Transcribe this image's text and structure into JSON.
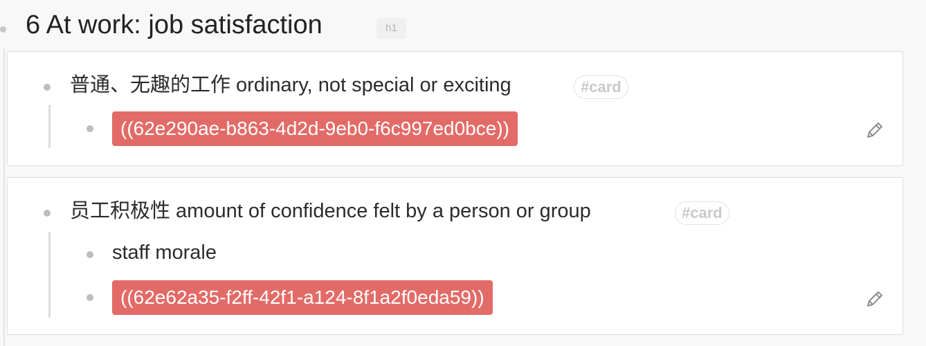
{
  "heading": {
    "title": "6 At work: job satisfaction",
    "badge": "h1"
  },
  "cards": [
    {
      "title": "普通、无趣的工作 ordinary, not special or exciting",
      "tag": "#card",
      "ref": "((62e290ae-b863-4d2d-9eb0-f6c997ed0bce))"
    },
    {
      "title": "员工积极性  amount of confidence felt by a person or group",
      "tag": "#card",
      "child_text": "staff morale",
      "ref": "((62e62a35-f2ff-42f1-a124-8f1a2f0eda59))"
    }
  ],
  "icons": {
    "edit": "pencil-icon",
    "bullet": "dot-icon"
  },
  "colors": {
    "block_ref_bg": "#e36b67",
    "tag_text": "#c9c9c9"
  }
}
